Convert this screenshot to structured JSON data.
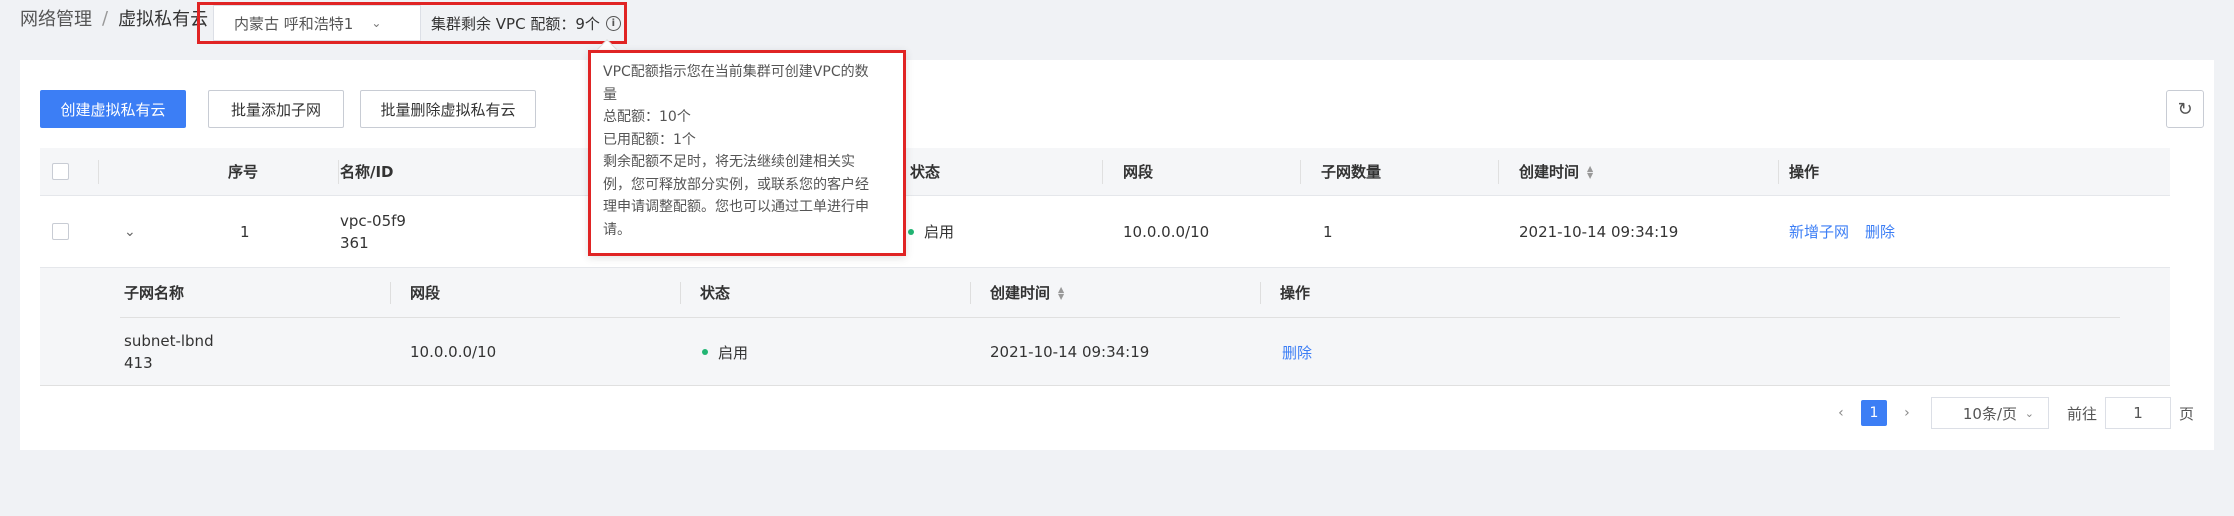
{
  "breadcrumb": {
    "parent": "网络管理",
    "separator": "/",
    "current": "虚拟私有云"
  },
  "region": {
    "selected": "内蒙古  呼和浩特1",
    "quota_label": "集群剩余 VPC 配额：9个"
  },
  "toolbar": {
    "create_label": "创建虚拟私有云",
    "batch_add_subnet_label": "批量添加子网",
    "batch_delete_label": "批量删除虚拟私有云",
    "refresh_icon": "↻"
  },
  "table": {
    "columns": {
      "index": "序号",
      "name": "名称/ID",
      "status": "状态",
      "cidr": "网段",
      "subnet_count": "子网数量",
      "created": "创建时间",
      "actions": "操作"
    },
    "row": {
      "index": "1",
      "name_line1": "vpc-05f9",
      "name_line2": "361",
      "status": "启用",
      "cidr": "10.0.0.0/10",
      "subnet_count": "1",
      "created": "2021-10-14 09:34:19",
      "action_add": "新增子网",
      "action_delete": "删除"
    }
  },
  "subtable": {
    "columns": {
      "name": "子网名称",
      "cidr": "网段",
      "status": "状态",
      "created": "创建时间",
      "actions": "操作"
    },
    "row": {
      "name_line1": "subnet-lbnd",
      "name_line2": "413",
      "cidr": "10.0.0.0/10",
      "status": "启用",
      "created": "2021-10-14 09:34:19",
      "action_delete": "删除"
    }
  },
  "pagination": {
    "prev": "‹",
    "page": "1",
    "next": "›",
    "page_size": "10条/页",
    "goto_prefix": "前往",
    "goto_value": "1",
    "goto_suffix": "页"
  },
  "tooltip": {
    "line1": "VPC配额指示您在当前集群可创建VPC的数",
    "line2": "量",
    "line3": "总配额：10个",
    "line4": "已用配额：1个",
    "line5": "剩余配额不足时，将无法继续创建相关实",
    "line6": "例，您可释放部分实例，或联系您的客户经",
    "line7": "理申请调整配额。您也可以通过工单进行申",
    "line8": "请。"
  },
  "colors": {
    "primary": "#3c7ef5",
    "highlight_border": "#e02424",
    "status_green": "#22b573"
  }
}
